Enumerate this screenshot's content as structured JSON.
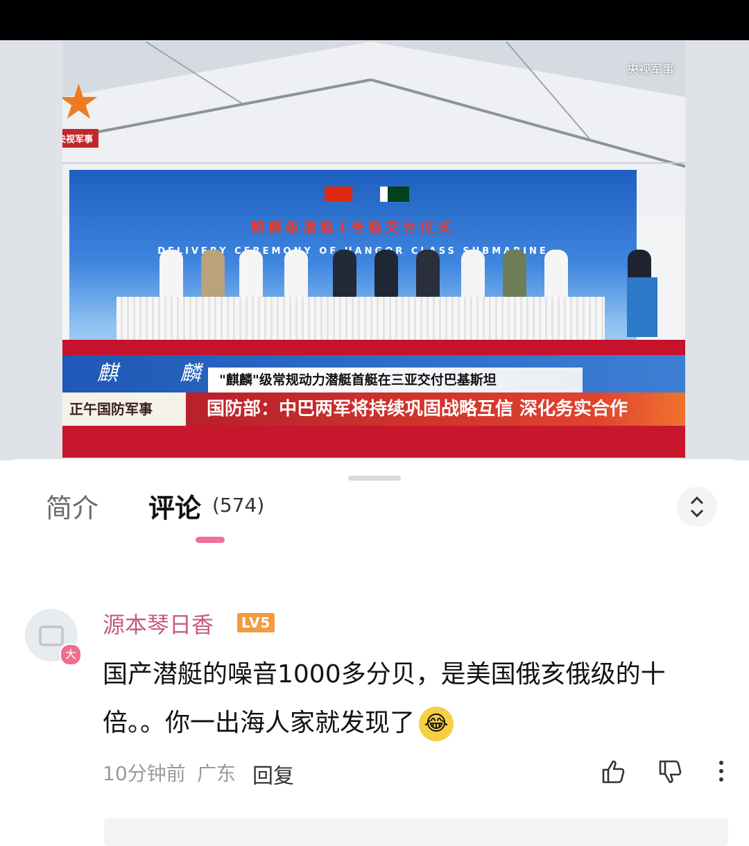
{
  "video": {
    "channel_logo_text": "央视军事",
    "watermark": "央视军事",
    "backdrop_title": "麒麟级潜艇1号艇交付仪式",
    "backdrop_subtitle": "DELIVERY CEREMONY OF HANGOR CLASS SUBMARINE",
    "lower_blue_text": "麒 麟",
    "headline_small": "\"麒麟\"级常规动力潜艇首艇在三亚交付巴基斯坦",
    "program_name": "正午国防军事",
    "headline_big": "国防部：中巴两军将持续巩固战略互信 深化务实合作"
  },
  "tabs": {
    "intro": "简介",
    "comments": "评论",
    "comments_count": "(574)"
  },
  "comment": {
    "avatar_badge": "大",
    "username": "源本琴日香",
    "level": "LV5",
    "text": "国产潜艇的噪音1000多分贝，是美国俄亥俄级的十倍。。你一出海人家就发现了",
    "time": "10分钟前",
    "region": "广东",
    "reply": "回复"
  },
  "colors": {
    "accent_pink": "#f0709a",
    "username": "#c55c7c",
    "level_badge": "#f29b3f"
  },
  "icons": [
    "sort-icon",
    "like-icon",
    "dislike-icon",
    "more-icon",
    "laughing-crying-emoji-icon"
  ]
}
